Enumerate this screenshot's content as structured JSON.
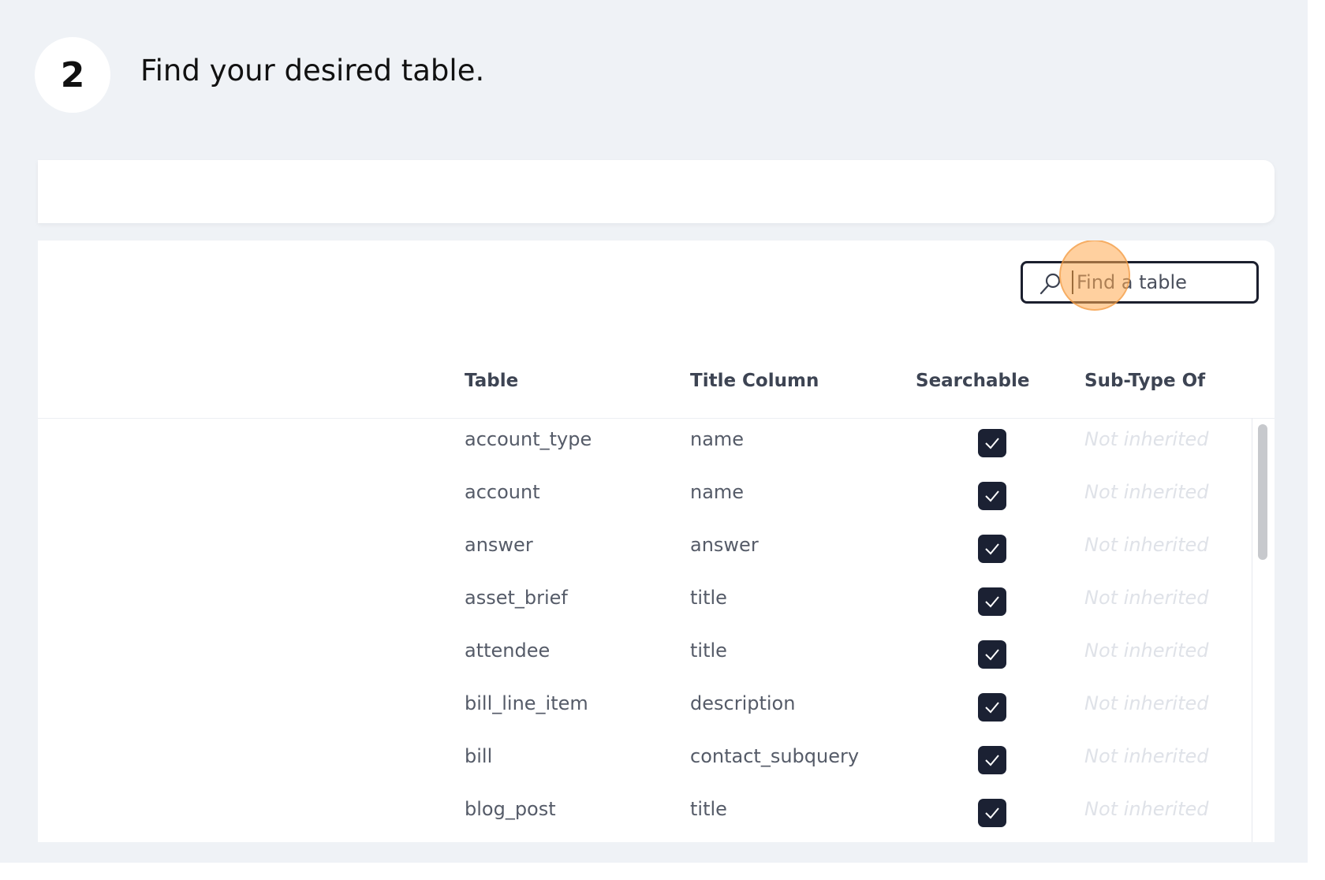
{
  "step": {
    "number": "2",
    "instruction": "Find your desired table."
  },
  "search": {
    "placeholder": "Find a table",
    "value": ""
  },
  "table": {
    "headers": [
      "Table",
      "Title Column",
      "Searchable",
      "Sub-Type Of"
    ],
    "rows": [
      {
        "table": "account_type",
        "title_column": "name",
        "searchable": true,
        "sub_type_of": "Not inherited"
      },
      {
        "table": "account",
        "title_column": "name",
        "searchable": true,
        "sub_type_of": "Not inherited"
      },
      {
        "table": "answer",
        "title_column": "answer",
        "searchable": true,
        "sub_type_of": "Not inherited"
      },
      {
        "table": "asset_brief",
        "title_column": "title",
        "searchable": true,
        "sub_type_of": "Not inherited"
      },
      {
        "table": "attendee",
        "title_column": "title",
        "searchable": true,
        "sub_type_of": "Not inherited"
      },
      {
        "table": "bill_line_item",
        "title_column": "description",
        "searchable": true,
        "sub_type_of": "Not inherited"
      },
      {
        "table": "bill",
        "title_column": "contact_subquery",
        "searchable": true,
        "sub_type_of": "Not inherited"
      },
      {
        "table": "blog_post",
        "title_column": "title",
        "searchable": true,
        "sub_type_of": "Not inherited"
      }
    ]
  },
  "colors": {
    "background": "#eff2f6",
    "checkbox": "#1b2133",
    "highlight": "#ffaa50"
  },
  "icons": {
    "search": "search-icon",
    "check": "check-icon"
  }
}
